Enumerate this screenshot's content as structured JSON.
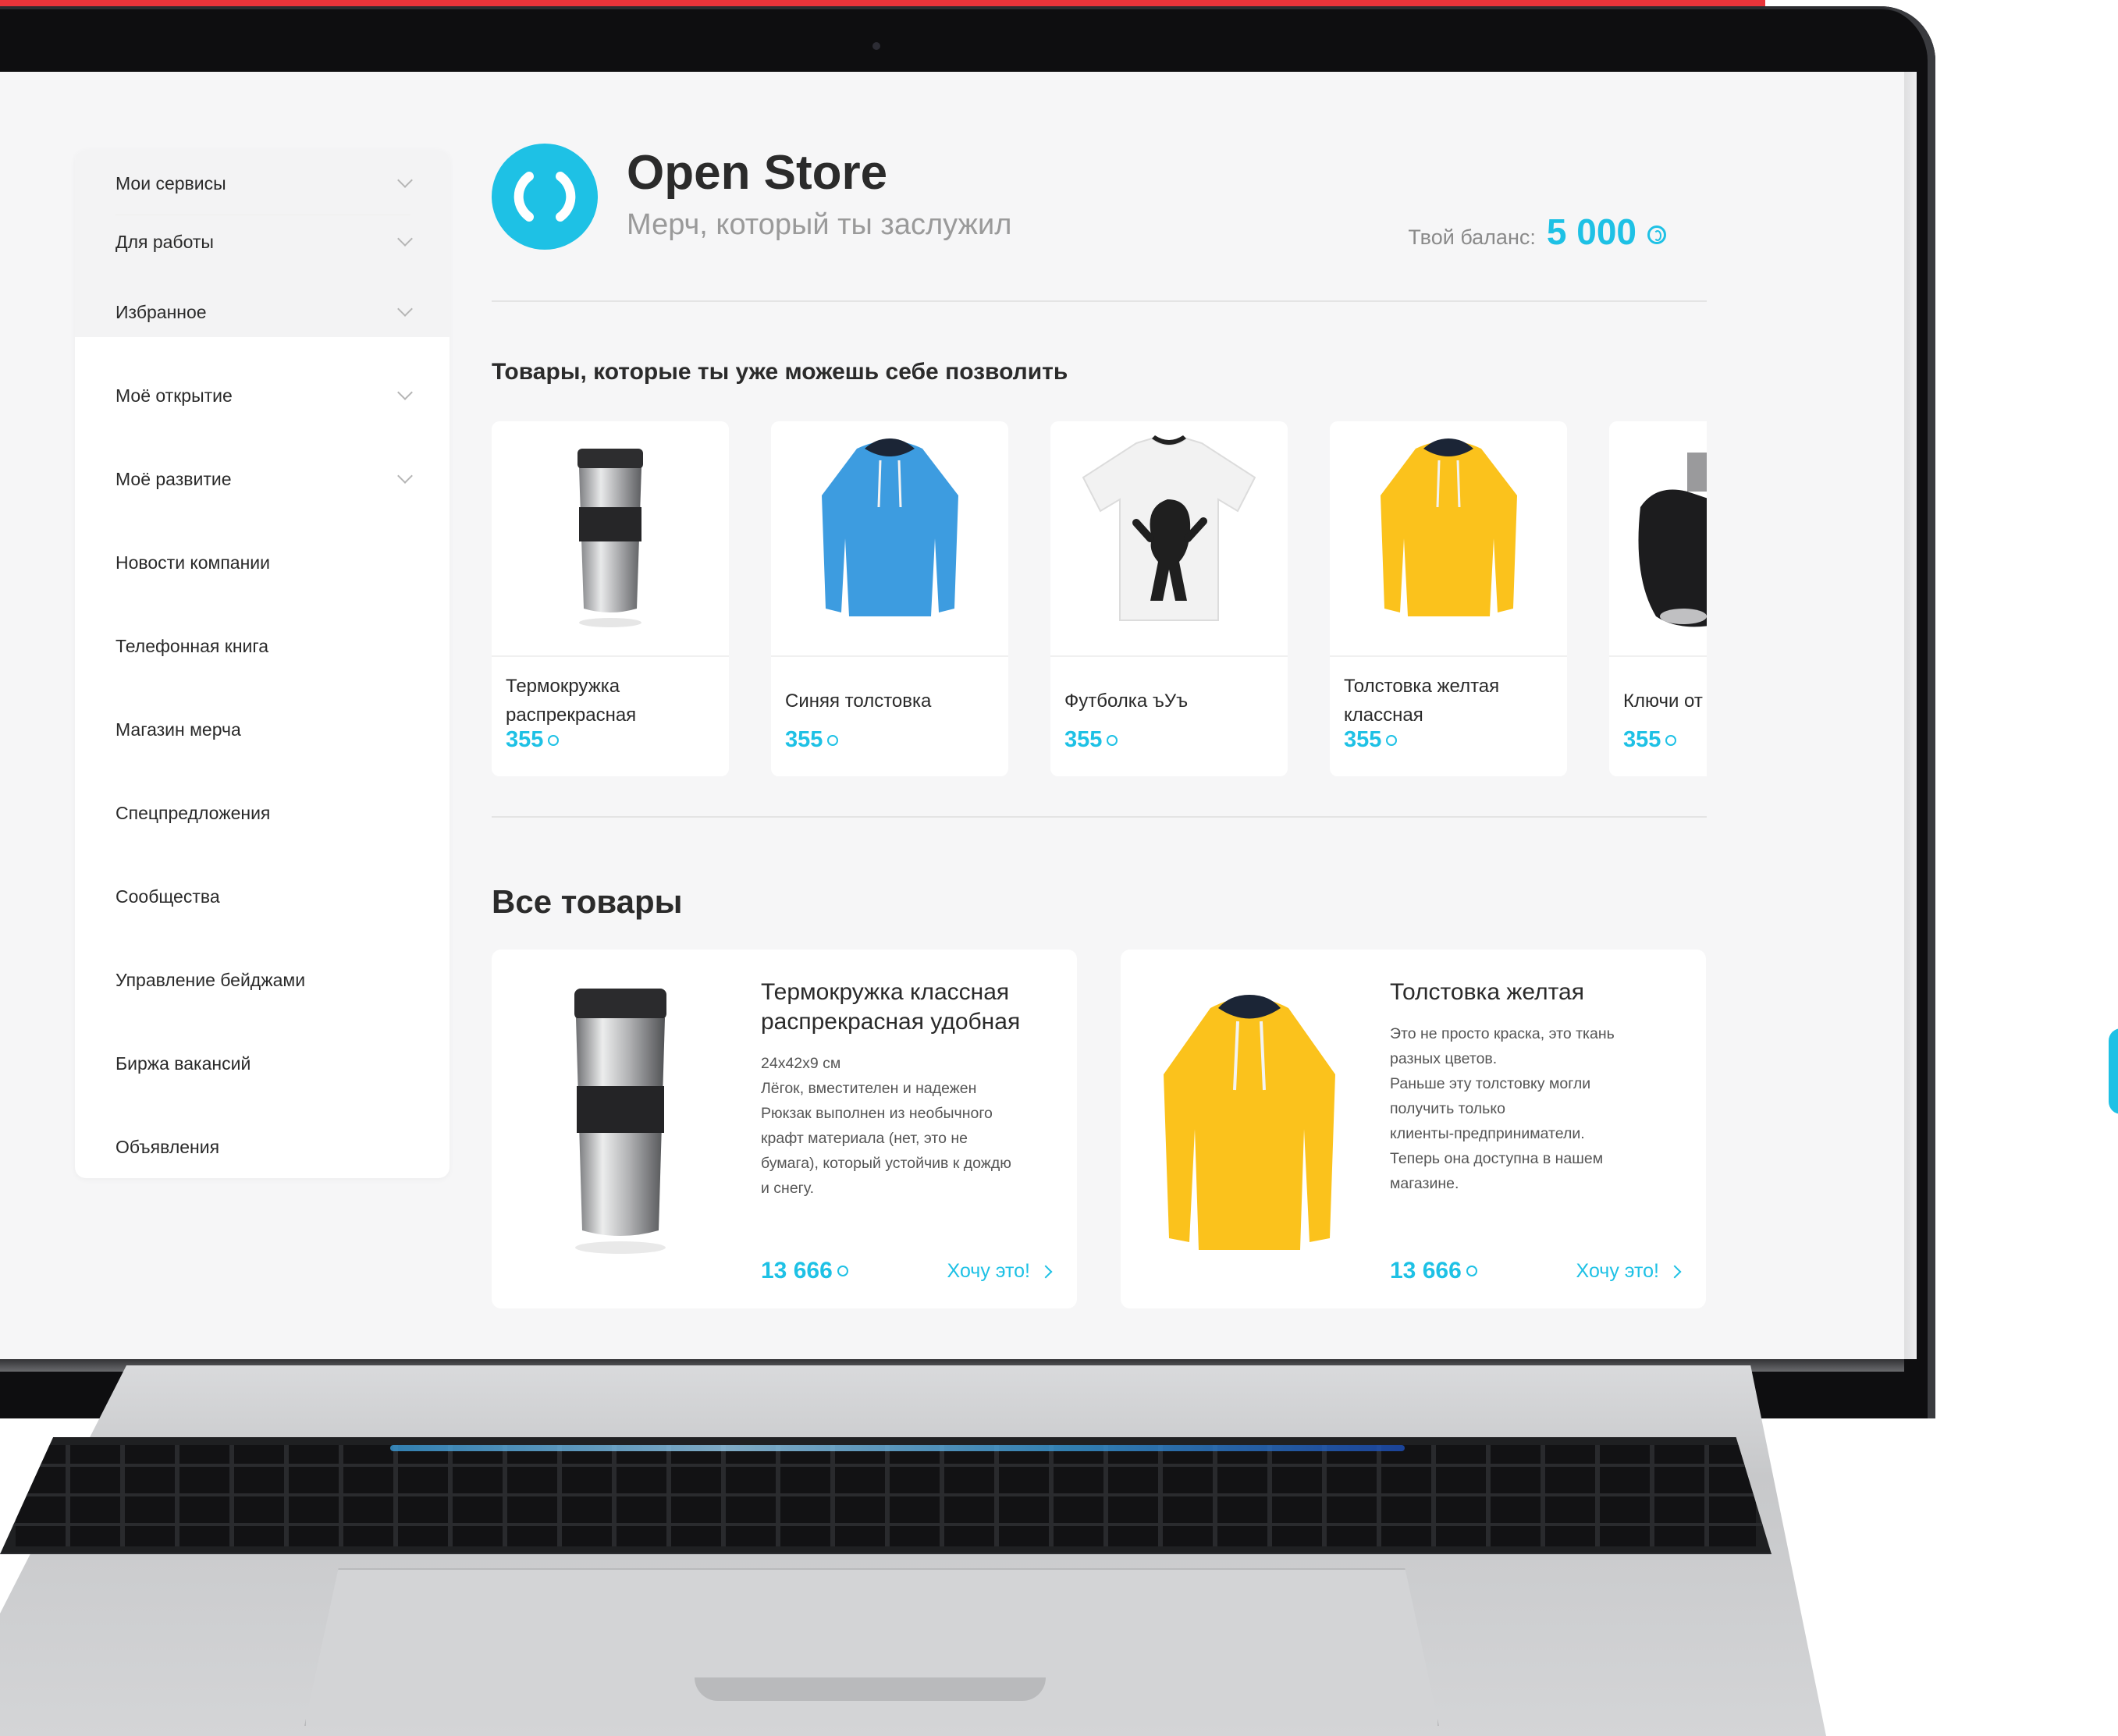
{
  "app": {
    "title": "Open Store",
    "subtitle": "Мерч, который ты заслужил",
    "balance_label": "Твой баланс:",
    "balance_value": "5 000",
    "accent_color": "#1ec1e5"
  },
  "sidebar": {
    "items": [
      {
        "label": "Мои сервисы",
        "has_dropdown": true
      },
      {
        "label": "Для работы",
        "has_dropdown": true
      },
      {
        "label": "Избранное",
        "has_dropdown": true
      },
      {
        "label": "Моё открытие",
        "has_dropdown": true
      },
      {
        "label": "Моё развитие",
        "has_dropdown": true
      },
      {
        "label": "Новости компании",
        "has_dropdown": false
      },
      {
        "label": "Телефонная книга",
        "has_dropdown": false
      },
      {
        "label": "Магазин мерча",
        "has_dropdown": false
      },
      {
        "label": "Спецпредложения",
        "has_dropdown": false
      },
      {
        "label": "Сообщества",
        "has_dropdown": false
      },
      {
        "label": "Управление бейджами",
        "has_dropdown": false
      },
      {
        "label": "Биржа вакансий",
        "has_dropdown": false
      },
      {
        "label": "Объявления",
        "has_dropdown": false
      }
    ]
  },
  "affordable": {
    "heading": "Товары, которые ты уже можешь себе позволить",
    "products": [
      {
        "name": "Термокружка распрекрасная",
        "price": "355",
        "icon": "thermo-mug-image"
      },
      {
        "name": "Синяя толстовка",
        "price": "355",
        "icon": "blue-hoodie-image"
      },
      {
        "name": "Футболка ъУъ",
        "price": "355",
        "icon": "tshirt-image"
      },
      {
        "name": "Толстовка желтая классная",
        "price": "355",
        "icon": "yellow-hoodie-image"
      },
      {
        "name": "Ключи от",
        "price": "355",
        "icon": "car-key-image"
      }
    ]
  },
  "all_products": {
    "heading": "Все товары",
    "products": [
      {
        "title": "Термокружка классная распрекрасная удобная",
        "desc": [
          "24x42x9 см",
          "Лёгок, вместителен и надежен",
          "Рюкзак выполнен из необычного",
          "крафт материала (нет, это не",
          "бумага), который устойчив к дождю",
          "и снегу."
        ],
        "price": "13 666",
        "button": "Хочу это!",
        "icon": "thermo-mug-image"
      },
      {
        "title": "Толстовка желтая",
        "desc": [
          "Это не просто краска, это ткань",
          "разных цветов.",
          "Раньше эту толстовку могли",
          "получить только",
          "клиенты-предприниматели.",
          "Теперь она доступна в нашем",
          "магазине."
        ],
        "price": "13 666",
        "button": "Хочу это!",
        "icon": "yellow-hoodie-image"
      }
    ]
  }
}
